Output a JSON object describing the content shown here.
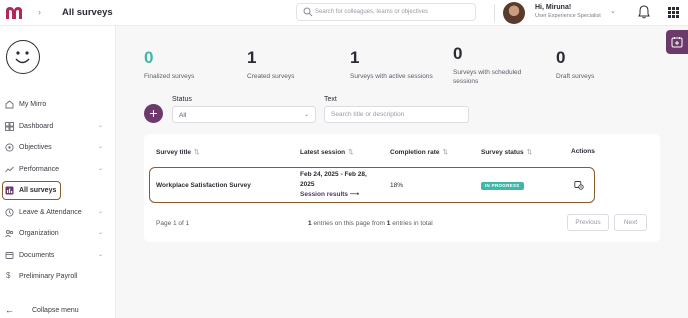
{
  "header": {
    "page_title": "All surveys",
    "search_placeholder": "Search for colleagues, teams or objectives",
    "user_greeting": "Hi, Miruna!",
    "user_role": "User Experience Specialist"
  },
  "sidebar": {
    "items": [
      {
        "label": "My Mirro",
        "icon": "home-icon",
        "chevron": false
      },
      {
        "label": "Dashboard",
        "icon": "dashboard-icon",
        "chevron": true
      },
      {
        "label": "Objectives",
        "icon": "target-icon",
        "chevron": true
      },
      {
        "label": "Performance",
        "icon": "trend-icon",
        "chevron": true
      },
      {
        "label": "All surveys",
        "icon": "survey-icon",
        "chevron": false,
        "active": true
      },
      {
        "label": "Leave & Attendance",
        "icon": "clock-icon",
        "chevron": true
      },
      {
        "label": "Organization",
        "icon": "org-icon",
        "chevron": true
      },
      {
        "label": "Documents",
        "icon": "document-icon",
        "chevron": true
      },
      {
        "label": "Preliminary Payroll",
        "icon": "dollar-icon",
        "chevron": false
      }
    ],
    "collapse_label": "Collapse menu"
  },
  "stats": [
    {
      "value": "0",
      "label": "Finalized surveys",
      "accent": "#3fb8a8"
    },
    {
      "value": "1",
      "label": "Created surveys"
    },
    {
      "value": "1",
      "label": "Surveys with active sessions"
    },
    {
      "value": "0",
      "label": "Surveys with scheduled sessions"
    },
    {
      "value": "0",
      "label": "Draft surveys"
    }
  ],
  "filters": {
    "status_label": "Status",
    "status_value": "All",
    "text_label": "Text",
    "text_placeholder": "Search title or description"
  },
  "table": {
    "columns": [
      "Survey title",
      "Latest session",
      "Completion rate",
      "Survey status",
      "Actions"
    ],
    "rows": [
      {
        "title": "Workplace Satisfaction Survey",
        "session_line1": "Feb 24, 2025 - Feb 28,",
        "session_line2": "2025",
        "session_link": "Session results",
        "completion": "18%",
        "status": "IN PROGRESS"
      }
    ],
    "pager": "Page 1 of 1",
    "entries_count": "1",
    "entries_mid": "entries on this page from",
    "entries_total": "1",
    "entries_end": "entries in total",
    "prev_label": "Previous",
    "next_label": "Next"
  },
  "colors": {
    "brand": "#6b3a6a",
    "teal": "#3fb8a8",
    "highlight": "#8a5a2a"
  }
}
